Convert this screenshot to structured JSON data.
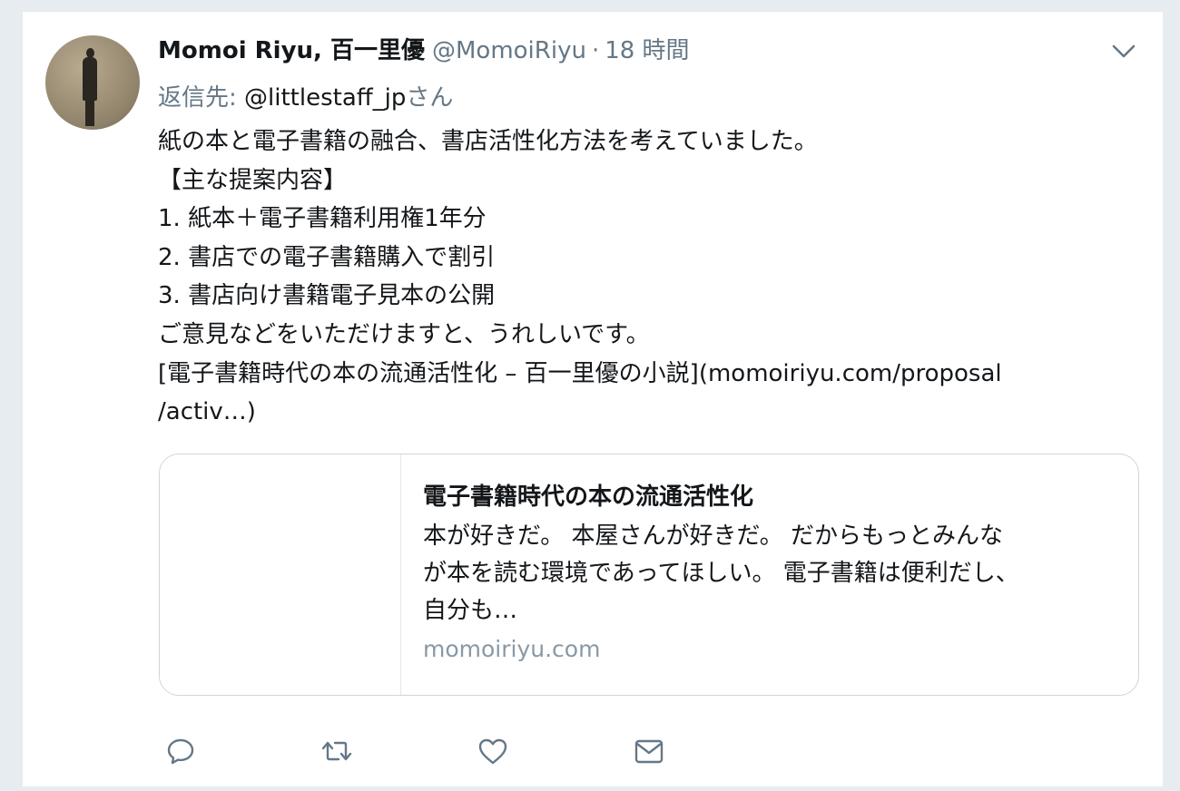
{
  "tweet": {
    "display_name": "Momoi Riyu, 百一里優",
    "handle": "@MomoiRiyu",
    "separator": "·",
    "timestamp": "18 時間",
    "reply_label": "返信先: ",
    "reply_handle": "@littlestaff_jp",
    "reply_suffix": "さん",
    "body_lines": [
      "紙の本と電子書籍の融合、書店活性化方法を考えていました。",
      "【主な提案内容】",
      "1. 紙本＋電子書籍利用権1年分",
      "2. 書店での電子書籍購入で割引",
      "3. 書店向け書籍電子見本の公開",
      "ご意見などをいただけますと、うれしいです。",
      "[電子書籍時代の本の流通活性化 – 百一里優の小説](momoiriyu.com/proposal",
      "/activ…)"
    ]
  },
  "card": {
    "title": "電子書籍時代の本の流通活性化",
    "description_lines": [
      "本が好きだ。 本屋さんが好きだ。 だからもっとみんな",
      "が本を読む環境であってほしい。 電子書籍は便利だし、",
      "自分も…"
    ],
    "domain": "momoiriyu.com"
  },
  "icons": {
    "menu": "chevron-down-icon",
    "reply": "reply-icon",
    "retweet": "retweet-icon",
    "like": "heart-icon",
    "dm": "envelope-icon"
  },
  "colors": {
    "background": "#e6ecf0",
    "secondary_text": "#657786",
    "primary_text": "#14171a",
    "border": "#ccd6dd"
  }
}
